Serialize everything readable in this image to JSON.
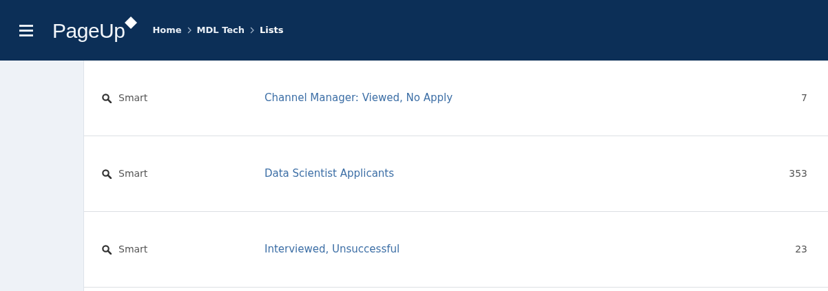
{
  "header": {
    "logo": "PageUp",
    "breadcrumb": [
      {
        "label": "Home",
        "current": false
      },
      {
        "label": "MDL Tech",
        "current": false
      },
      {
        "label": "Lists",
        "current": true
      }
    ]
  },
  "lists": [
    {
      "type": "Smart",
      "name": "Channel Manager: Viewed, No Apply",
      "count": "7"
    },
    {
      "type": "Smart",
      "name": "Data Scientist Applicants",
      "count": "353"
    },
    {
      "type": "Smart",
      "name": "Interviewed, Unsuccessful",
      "count": "23"
    }
  ]
}
